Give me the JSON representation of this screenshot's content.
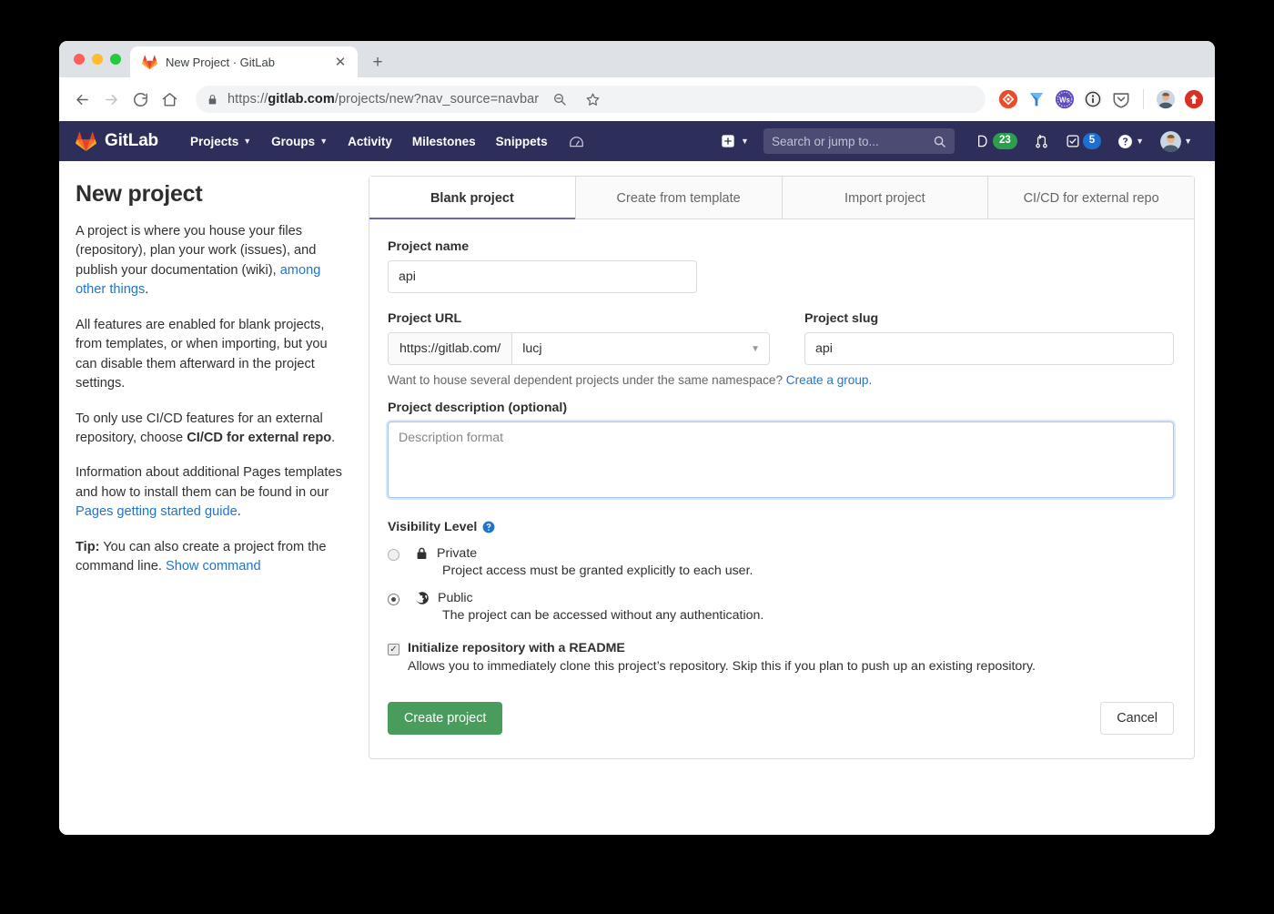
{
  "browser": {
    "tab": {
      "title": "New Project · GitLab",
      "favicon": "gitlab-favicon",
      "close_label": "✕"
    },
    "new_tab_label": "+",
    "toolbar": {
      "back_label": "←",
      "forward_label": "→",
      "reload_label": "↻",
      "home_label": "⌂",
      "url_secure_prefix": "https://",
      "url_domain": "gitlab.com",
      "url_path": "/projects/new?nav_source=navbar",
      "zoom_icon": "zoom-out-icon",
      "bookmark_icon": "star-icon",
      "extensions": [
        {
          "name": "extension-icon-orange-diamond",
          "color": "#ea4c2a"
        },
        {
          "name": "extension-icon-blue-y",
          "color": "#2d7fd4"
        },
        {
          "name": "extension-icon-purple-ws",
          "color": "#5b4bc4"
        },
        {
          "name": "extension-icon-info-circle",
          "color": "#2b2b2b"
        },
        {
          "name": "extension-icon-pocket-shield",
          "color": "#5f6368"
        }
      ],
      "profile_avatar": "browser-profile-avatar",
      "menu_icon": "update-menu-icon"
    }
  },
  "gitlab_navbar": {
    "brand": "GitLab",
    "links": [
      {
        "label": "Projects",
        "has_caret": true
      },
      {
        "label": "Groups",
        "has_caret": true
      },
      {
        "label": "Activity",
        "has_caret": false
      },
      {
        "label": "Milestones",
        "has_caret": false
      },
      {
        "label": "Snippets",
        "has_caret": false
      }
    ],
    "gauge_icon": "speedometer-icon",
    "plus_icon": "plus-square-icon",
    "search_placeholder": "Search or jump to...",
    "issues": {
      "icon": "issues-icon",
      "count": "23",
      "badge_color": "#2e9e4e"
    },
    "merge_requests": {
      "icon": "merge-request-icon",
      "count": ""
    },
    "todos": {
      "icon": "todo-icon",
      "count": "5",
      "badge_color": "#1f6fd0"
    },
    "help_icon": "help-circle-icon",
    "user_avatar": "user-avatar",
    "bg_color": "#2e2e5a"
  },
  "intro": {
    "title": "New project",
    "p1_a": "A project is where you house your files (repository), plan your work (issues), and publish your documentation (wiki), ",
    "p1_link": "among other things",
    "p1_b": ".",
    "p2": "All features are enabled for blank projects, from templates, or when importing, but you can disable them afterward in the project settings.",
    "p3_a": "To only use CI/CD features for an external repository, choose ",
    "p3_bold": "CI/CD for external repo",
    "p3_b": ".",
    "p4_a": "Information about additional Pages templates and how to install them can be found in our ",
    "p4_link": "Pages getting started guide",
    "p4_b": ".",
    "p5_bold": "Tip:",
    "p5_a": " You can also create a project from the command line. ",
    "p5_link": "Show command"
  },
  "form": {
    "tabs": [
      {
        "label": "Blank project",
        "active": true
      },
      {
        "label": "Create from template",
        "active": false
      },
      {
        "label": "Import project",
        "active": false
      },
      {
        "label": "CI/CD for external repo",
        "active": false
      }
    ],
    "project_name": {
      "label": "Project name",
      "value": "api",
      "placeholder": ""
    },
    "project_url": {
      "label": "Project URL",
      "prefix": "https://gitlab.com/",
      "namespace": "lucj",
      "caret": "⌄"
    },
    "project_slug": {
      "label": "Project slug",
      "value": "api",
      "placeholder": ""
    },
    "namespace_helper": {
      "text": "Want to house several dependent projects under the same namespace? ",
      "link": "Create a group."
    },
    "description": {
      "label": "Project description (optional)",
      "placeholder": "Description format",
      "value": ""
    },
    "visibility": {
      "title": "Visibility Level",
      "help_icon": "help-circle-icon",
      "options": [
        {
          "name": "Private",
          "icon": "lock-icon",
          "description": "Project access must be granted explicitly to each user.",
          "selected": false
        },
        {
          "name": "Public",
          "icon": "globe-icon",
          "description": "The project can be accessed without any authentication.",
          "selected": true
        }
      ]
    },
    "readme": {
      "label": "Initialize repository with a README",
      "description": "Allows you to immediately clone this project’s repository. Skip this if you plan to push up an existing repository.",
      "checked": true,
      "check_glyph": "✓"
    },
    "create_button": "Create project",
    "cancel_button": "Cancel",
    "accent_color": "#6666c4",
    "primary_button_color": "#4a9c5d"
  }
}
